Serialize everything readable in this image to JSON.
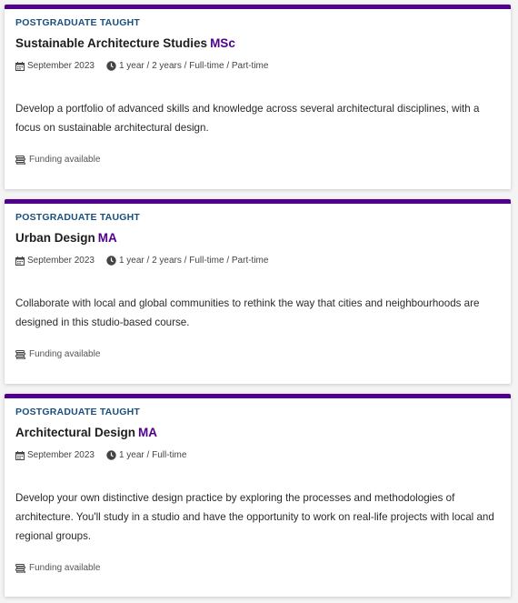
{
  "courses": [
    {
      "category": "POSTGRADUATE TAUGHT",
      "title": "Sustainable Architecture Studies",
      "award": "MSc",
      "start": "September 2023",
      "duration": "1 year / 2 years / Full-time / Part-time",
      "description": "Develop a portfolio of advanced skills and knowledge across several architectural disciplines, with a focus on sustainable architectural design.",
      "funding": "Funding available"
    },
    {
      "category": "POSTGRADUATE TAUGHT",
      "title": "Urban Design",
      "award": "MA",
      "start": "September 2023",
      "duration": "1 year / 2 years / Full-time / Part-time",
      "description": "Collaborate with local and global communities to rethink the way that cities and neighbourhoods are designed in this studio-based course.",
      "funding": "Funding available"
    },
    {
      "category": "POSTGRADUATE TAUGHT",
      "title": "Architectural Design",
      "award": "MA",
      "start": "September 2023",
      "duration": "1 year / Full-time",
      "description": "Develop your own distinctive design practice by exploring the processes and methodologies of architecture. You'll study in a studio and have the opportunity to work on real-life projects with local and regional groups.",
      "funding": "Funding available"
    }
  ],
  "colors": {
    "accent": "#51008c",
    "category": "#1b4f7e"
  },
  "icons": {
    "start": "calendar-icon",
    "duration": "clock-icon",
    "funding": "coins-icon"
  }
}
